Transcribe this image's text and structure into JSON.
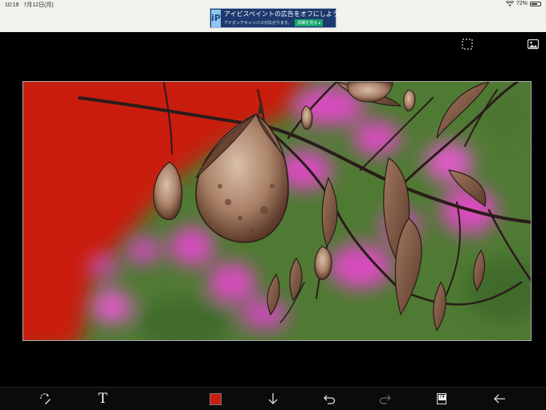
{
  "status_bar": {
    "time": "10:19",
    "date": "7月12日(月)",
    "battery": "72%",
    "battery_level": 0.72
  },
  "ad": {
    "logo": "iP",
    "headline": "アイビスペイントの広告をオフにしよう!",
    "subtext": "アドオンでキャンバスが広がります。",
    "cta": "詳細を見る ▸"
  },
  "top_tools": {
    "selection_icon": "dashed-selection-icon",
    "reference_icon": "image-icon"
  },
  "toolbar": {
    "text_tool_label": "T",
    "current_color": "#c91d10",
    "layer_count": "74",
    "icons": [
      "transform-tool-icon",
      "text-tool-icon",
      "color-swatch",
      "down-arrow-icon",
      "undo-icon",
      "redo-icon",
      "layers-icon",
      "back-arrow-icon"
    ]
  },
  "canvas": {
    "colors": {
      "red_background": "#c91d10",
      "green_background": "#4f7a33",
      "pink_flowers": "#d94bbf",
      "branch": "#2a1c1a",
      "seed_pod": "#b28d75",
      "leaf": "#8c5f48"
    }
  }
}
